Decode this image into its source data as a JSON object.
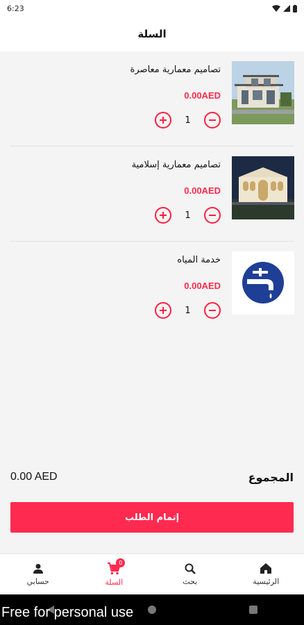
{
  "status": {
    "time": "6:23"
  },
  "header": {
    "title": "السلة"
  },
  "items": [
    {
      "name": "تصاميم معمارية معاصرة",
      "price": "0.00AED",
      "qty": "1",
      "thumb": "modern-villa-image"
    },
    {
      "name": "تصاميم معمارية إسلامية",
      "price": "0.00AED",
      "qty": "1",
      "thumb": "islamic-villa-image"
    },
    {
      "name": "خدمة المياه",
      "price": "0.00AED",
      "qty": "1",
      "thumb": "water-tap-image"
    }
  ],
  "total": {
    "label": "المجموع",
    "amount": "0.00 AED"
  },
  "checkout": {
    "label": "إتمام الطلب"
  },
  "nav": {
    "home": "الرئيسية",
    "search": "بحث",
    "cart": "السلة",
    "account": "حسابي",
    "cart_badge": "0"
  },
  "watermark": "Free for personal use",
  "colors": {
    "accent": "#ff2a4f",
    "price": "#ff2a4a"
  }
}
